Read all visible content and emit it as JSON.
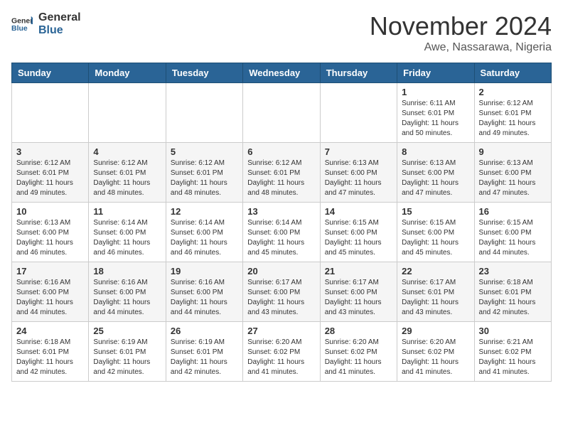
{
  "header": {
    "logo_line1": "General",
    "logo_line2": "Blue",
    "month": "November 2024",
    "location": "Awe, Nassarawa, Nigeria"
  },
  "weekdays": [
    "Sunday",
    "Monday",
    "Tuesday",
    "Wednesday",
    "Thursday",
    "Friday",
    "Saturday"
  ],
  "weeks": [
    [
      {
        "day": "",
        "info": ""
      },
      {
        "day": "",
        "info": ""
      },
      {
        "day": "",
        "info": ""
      },
      {
        "day": "",
        "info": ""
      },
      {
        "day": "",
        "info": ""
      },
      {
        "day": "1",
        "info": "Sunrise: 6:11 AM\nSunset: 6:01 PM\nDaylight: 11 hours\nand 50 minutes."
      },
      {
        "day": "2",
        "info": "Sunrise: 6:12 AM\nSunset: 6:01 PM\nDaylight: 11 hours\nand 49 minutes."
      }
    ],
    [
      {
        "day": "3",
        "info": "Sunrise: 6:12 AM\nSunset: 6:01 PM\nDaylight: 11 hours\nand 49 minutes."
      },
      {
        "day": "4",
        "info": "Sunrise: 6:12 AM\nSunset: 6:01 PM\nDaylight: 11 hours\nand 48 minutes."
      },
      {
        "day": "5",
        "info": "Sunrise: 6:12 AM\nSunset: 6:01 PM\nDaylight: 11 hours\nand 48 minutes."
      },
      {
        "day": "6",
        "info": "Sunrise: 6:12 AM\nSunset: 6:01 PM\nDaylight: 11 hours\nand 48 minutes."
      },
      {
        "day": "7",
        "info": "Sunrise: 6:13 AM\nSunset: 6:00 PM\nDaylight: 11 hours\nand 47 minutes."
      },
      {
        "day": "8",
        "info": "Sunrise: 6:13 AM\nSunset: 6:00 PM\nDaylight: 11 hours\nand 47 minutes."
      },
      {
        "day": "9",
        "info": "Sunrise: 6:13 AM\nSunset: 6:00 PM\nDaylight: 11 hours\nand 47 minutes."
      }
    ],
    [
      {
        "day": "10",
        "info": "Sunrise: 6:13 AM\nSunset: 6:00 PM\nDaylight: 11 hours\nand 46 minutes."
      },
      {
        "day": "11",
        "info": "Sunrise: 6:14 AM\nSunset: 6:00 PM\nDaylight: 11 hours\nand 46 minutes."
      },
      {
        "day": "12",
        "info": "Sunrise: 6:14 AM\nSunset: 6:00 PM\nDaylight: 11 hours\nand 46 minutes."
      },
      {
        "day": "13",
        "info": "Sunrise: 6:14 AM\nSunset: 6:00 PM\nDaylight: 11 hours\nand 45 minutes."
      },
      {
        "day": "14",
        "info": "Sunrise: 6:15 AM\nSunset: 6:00 PM\nDaylight: 11 hours\nand 45 minutes."
      },
      {
        "day": "15",
        "info": "Sunrise: 6:15 AM\nSunset: 6:00 PM\nDaylight: 11 hours\nand 45 minutes."
      },
      {
        "day": "16",
        "info": "Sunrise: 6:15 AM\nSunset: 6:00 PM\nDaylight: 11 hours\nand 44 minutes."
      }
    ],
    [
      {
        "day": "17",
        "info": "Sunrise: 6:16 AM\nSunset: 6:00 PM\nDaylight: 11 hours\nand 44 minutes."
      },
      {
        "day": "18",
        "info": "Sunrise: 6:16 AM\nSunset: 6:00 PM\nDaylight: 11 hours\nand 44 minutes."
      },
      {
        "day": "19",
        "info": "Sunrise: 6:16 AM\nSunset: 6:00 PM\nDaylight: 11 hours\nand 44 minutes."
      },
      {
        "day": "20",
        "info": "Sunrise: 6:17 AM\nSunset: 6:00 PM\nDaylight: 11 hours\nand 43 minutes."
      },
      {
        "day": "21",
        "info": "Sunrise: 6:17 AM\nSunset: 6:00 PM\nDaylight: 11 hours\nand 43 minutes."
      },
      {
        "day": "22",
        "info": "Sunrise: 6:17 AM\nSunset: 6:01 PM\nDaylight: 11 hours\nand 43 minutes."
      },
      {
        "day": "23",
        "info": "Sunrise: 6:18 AM\nSunset: 6:01 PM\nDaylight: 11 hours\nand 42 minutes."
      }
    ],
    [
      {
        "day": "24",
        "info": "Sunrise: 6:18 AM\nSunset: 6:01 PM\nDaylight: 11 hours\nand 42 minutes."
      },
      {
        "day": "25",
        "info": "Sunrise: 6:19 AM\nSunset: 6:01 PM\nDaylight: 11 hours\nand 42 minutes."
      },
      {
        "day": "26",
        "info": "Sunrise: 6:19 AM\nSunset: 6:01 PM\nDaylight: 11 hours\nand 42 minutes."
      },
      {
        "day": "27",
        "info": "Sunrise: 6:20 AM\nSunset: 6:02 PM\nDaylight: 11 hours\nand 41 minutes."
      },
      {
        "day": "28",
        "info": "Sunrise: 6:20 AM\nSunset: 6:02 PM\nDaylight: 11 hours\nand 41 minutes."
      },
      {
        "day": "29",
        "info": "Sunrise: 6:20 AM\nSunset: 6:02 PM\nDaylight: 11 hours\nand 41 minutes."
      },
      {
        "day": "30",
        "info": "Sunrise: 6:21 AM\nSunset: 6:02 PM\nDaylight: 11 hours\nand 41 minutes."
      }
    ]
  ]
}
